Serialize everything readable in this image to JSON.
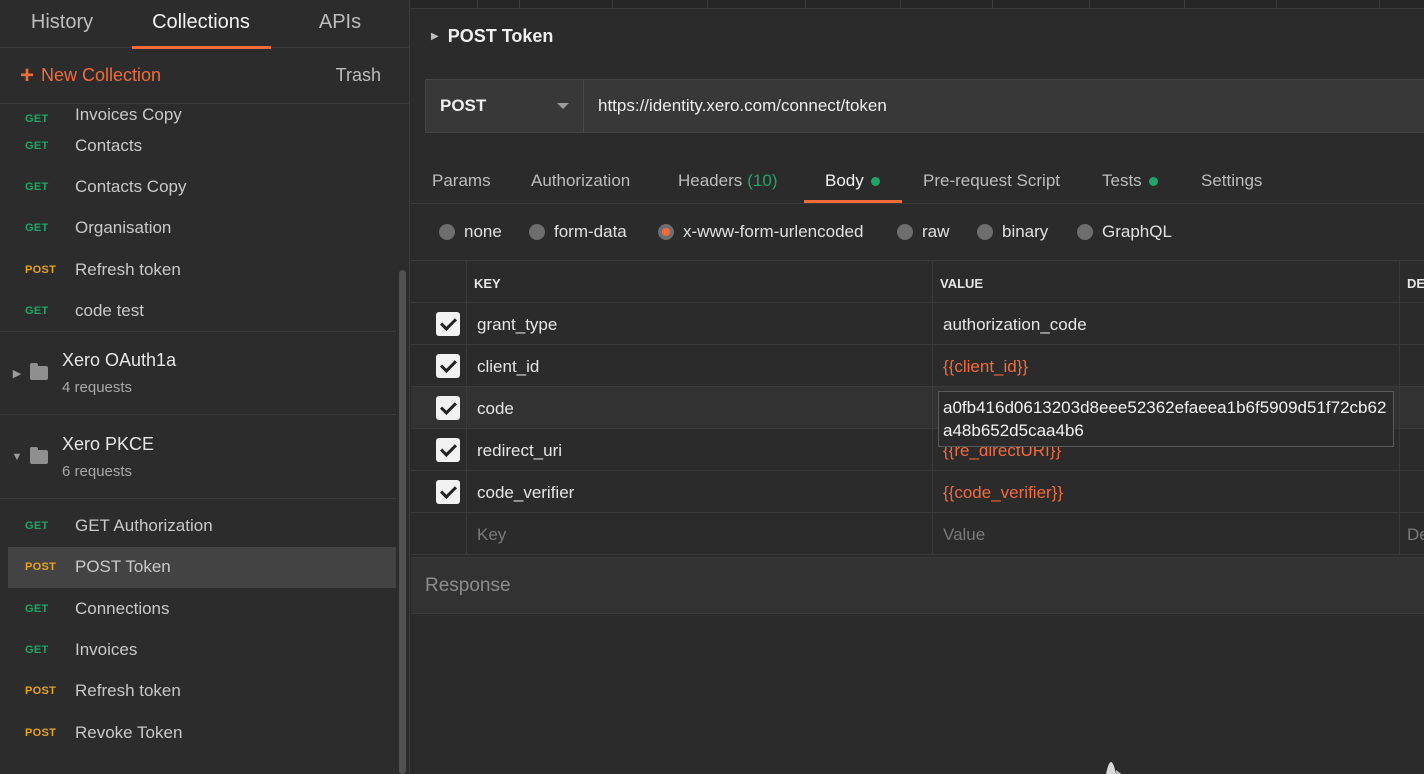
{
  "sidebar": {
    "tabs": [
      "History",
      "Collections",
      "APIs"
    ],
    "active_tab": "Collections",
    "new_collection_label": "New Collection",
    "trash_label": "Trash",
    "top_requests": [
      {
        "method": "GET",
        "name": "Invoices Copy"
      },
      {
        "method": "GET",
        "name": "Contacts"
      },
      {
        "method": "GET",
        "name": "Contacts Copy"
      },
      {
        "method": "GET",
        "name": "Organisation"
      },
      {
        "method": "POST",
        "name": "Refresh token"
      },
      {
        "method": "GET",
        "name": "code test"
      }
    ],
    "folders": [
      {
        "name": "Xero OAuth1a",
        "count": "4 requests",
        "expanded": false
      },
      {
        "name": "Xero PKCE",
        "count": "6 requests",
        "expanded": true
      }
    ],
    "pkce_requests": [
      {
        "method": "GET",
        "name": "GET Authorization"
      },
      {
        "method": "POST",
        "name": "POST Token"
      },
      {
        "method": "GET",
        "name": "Connections"
      },
      {
        "method": "GET",
        "name": "Invoices"
      },
      {
        "method": "POST",
        "name": "Refresh token"
      },
      {
        "method": "POST",
        "name": "Revoke Token"
      }
    ],
    "selected_request": "POST Token"
  },
  "request": {
    "title": "POST Token",
    "method": "POST",
    "url": "https://identity.xero.com/connect/token"
  },
  "sub_tabs": {
    "params": "Params",
    "authorization": "Authorization",
    "headers": "Headers",
    "headers_count": "(10)",
    "body": "Body",
    "prerequest": "Pre-request Script",
    "tests": "Tests",
    "settings": "Settings"
  },
  "body_types": {
    "none": "none",
    "form_data": "form-data",
    "urlencoded": "x-www-form-urlencoded",
    "raw": "raw",
    "binary": "binary",
    "graphql": "GraphQL",
    "selected": "x-www-form-urlencoded"
  },
  "table": {
    "key_header": "KEY",
    "value_header": "VALUE",
    "desc_header": "DE",
    "rows": [
      {
        "key": "grant_type",
        "value": "authorization_code",
        "is_var": false,
        "checked": true
      },
      {
        "key": "client_id",
        "value": "{{client_id}}",
        "is_var": true,
        "checked": true
      },
      {
        "key": "code",
        "value": "a0fb416d0613203d8eee52362efaeea1b6f5909d51f72cb62a48b652d5caa4b6",
        "is_var": false,
        "checked": true
      },
      {
        "key": "redirect_uri",
        "value": "{{re_directURI}}",
        "is_var": true,
        "checked": true
      },
      {
        "key": "code_verifier",
        "value": "{{code_verifier}}",
        "is_var": true,
        "checked": true
      }
    ],
    "key_placeholder": "Key",
    "value_placeholder": "Value",
    "desc_placeholder": "De"
  },
  "response": {
    "label": "Response"
  },
  "colors": {
    "accent": "#f26b3a",
    "get": "#1ea66a",
    "post": "#e8a317",
    "background": "#2b2b2b"
  }
}
